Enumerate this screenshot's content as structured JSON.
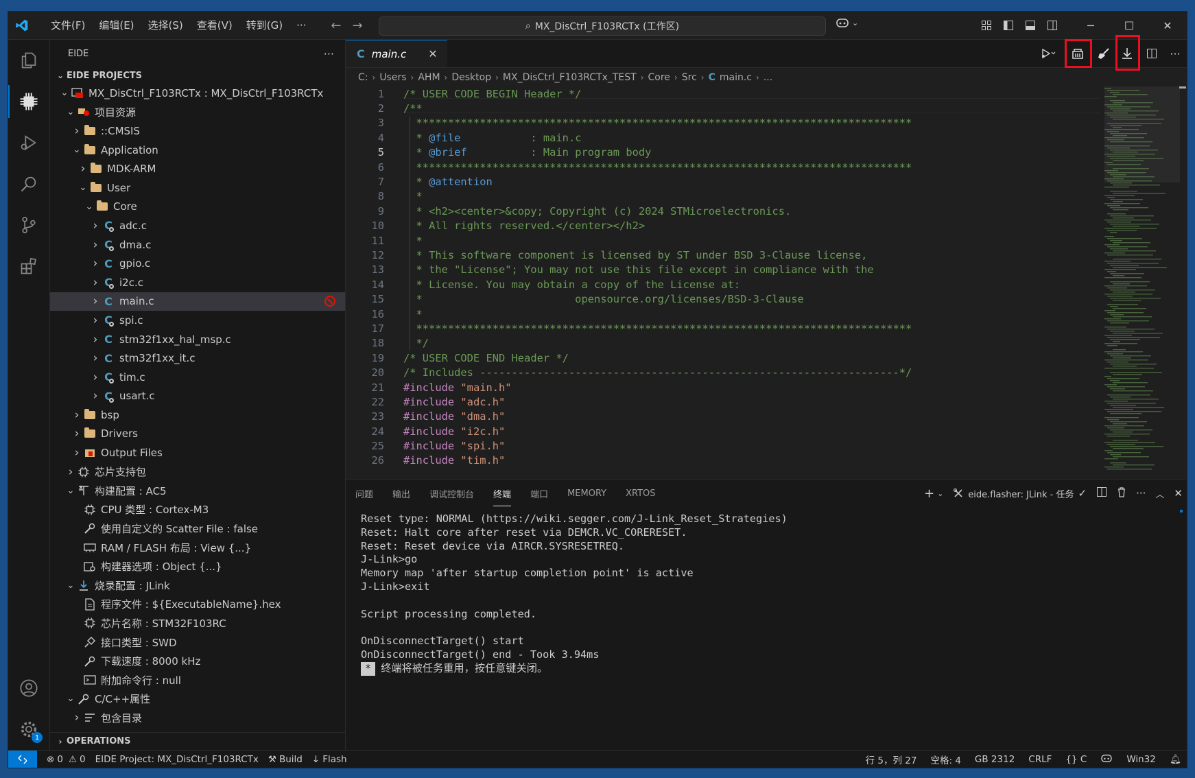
{
  "titlebar": {
    "menu": [
      "文件(F)",
      "编辑(E)",
      "选择(S)",
      "查看(V)",
      "转到(G)",
      "···"
    ],
    "search_text": "MX_DisCtrl_F103RCTx (工作区)"
  },
  "sidebar": {
    "header": "EIDE",
    "section": "EIDE PROJECTS",
    "operations": "OPERATIONS",
    "tree": [
      {
        "indent": 1,
        "chev": "v",
        "icon": "project",
        "label": "MX_DisCtrl_F103RCTx : MX_DisCtrl_F103RCTx"
      },
      {
        "indent": 2,
        "chev": "v",
        "icon": "resource",
        "label": "项目资源"
      },
      {
        "indent": 3,
        "chev": ">",
        "icon": "folder",
        "label": "::CMSIS"
      },
      {
        "indent": 3,
        "chev": "v",
        "icon": "folder",
        "label": "Application"
      },
      {
        "indent": 4,
        "chev": ">",
        "icon": "folder",
        "label": "MDK-ARM"
      },
      {
        "indent": 4,
        "chev": "v",
        "icon": "folder",
        "label": "User"
      },
      {
        "indent": 5,
        "chev": "v",
        "icon": "folder",
        "label": "Core"
      },
      {
        "indent": 6,
        "chev": ">",
        "icon": "cgear",
        "label": "adc.c"
      },
      {
        "indent": 6,
        "chev": ">",
        "icon": "cgear",
        "label": "dma.c"
      },
      {
        "indent": 6,
        "chev": ">",
        "icon": "c",
        "label": "gpio.c"
      },
      {
        "indent": 6,
        "chev": ">",
        "icon": "cgear",
        "label": "i2c.c"
      },
      {
        "indent": 6,
        "chev": ">",
        "icon": "c",
        "label": "main.c",
        "selected": true,
        "excluded": true
      },
      {
        "indent": 6,
        "chev": ">",
        "icon": "cgear",
        "label": "spi.c"
      },
      {
        "indent": 6,
        "chev": ">",
        "icon": "c",
        "label": "stm32f1xx_hal_msp.c"
      },
      {
        "indent": 6,
        "chev": ">",
        "icon": "c",
        "label": "stm32f1xx_it.c"
      },
      {
        "indent": 6,
        "chev": ">",
        "icon": "cgear",
        "label": "tim.c"
      },
      {
        "indent": 6,
        "chev": ">",
        "icon": "cgear",
        "label": "usart.c"
      },
      {
        "indent": 3,
        "chev": ">",
        "icon": "folder",
        "label": "bsp"
      },
      {
        "indent": 3,
        "chev": ">",
        "icon": "folder",
        "label": "Drivers"
      },
      {
        "indent": 3,
        "chev": ">",
        "icon": "output",
        "label": "Output Files"
      },
      {
        "indent": 2,
        "chev": ">",
        "icon": "chip",
        "label": "芯片支持包"
      },
      {
        "indent": 2,
        "chev": "v",
        "icon": "build",
        "label": "构建配置 : AC5"
      },
      {
        "indent": 3,
        "chev": "",
        "icon": "chip",
        "label": "CPU 类型 : Cortex-M3"
      },
      {
        "indent": 3,
        "chev": "",
        "icon": "wrench",
        "label": "使用自定义的 Scatter File : false"
      },
      {
        "indent": 3,
        "chev": "",
        "icon": "memory",
        "label": "RAM / FLASH 布局 : View {...}"
      },
      {
        "indent": 3,
        "chev": "",
        "icon": "options",
        "label": "构建器选项 : Object {...}"
      },
      {
        "indent": 2,
        "chev": "v",
        "icon": "download",
        "label": "烧录配置 : JLink"
      },
      {
        "indent": 3,
        "chev": "",
        "icon": "file",
        "label": "程序文件 : ${ExecutableName}.hex"
      },
      {
        "indent": 3,
        "chev": "",
        "icon": "chip",
        "label": "芯片名称 : STM32F103RC"
      },
      {
        "indent": 3,
        "chev": "",
        "icon": "plug",
        "label": "接口类型 : SWD"
      },
      {
        "indent": 3,
        "chev": "",
        "icon": "wrench",
        "label": "下载速度 : 8000 kHz"
      },
      {
        "indent": 3,
        "chev": "",
        "icon": "terminal",
        "label": "附加命令行 : null"
      },
      {
        "indent": 2,
        "chev": "v",
        "icon": "wrench",
        "label": "C/C++属性"
      },
      {
        "indent": 3,
        "chev": ">",
        "icon": "list",
        "label": "包含目录"
      }
    ]
  },
  "editor": {
    "tab_label": "main.c",
    "breadcrumb": [
      "C:",
      "Users",
      "AHM",
      "Desktop",
      "MX_DisCtrl_F103RCTx_TEST",
      "Core",
      "Src",
      "main.c",
      "..."
    ],
    "current_line": 5,
    "lines": [
      {
        "n": "1",
        "type": "comment",
        "text": "/* USER CODE BEGIN Header */"
      },
      {
        "n": "2",
        "type": "comment",
        "text": "/**"
      },
      {
        "n": "3",
        "type": "comment",
        "text": "  ******************************************************************************"
      },
      {
        "n": "4",
        "type": "tagc",
        "pre": "  * ",
        "tag": "@file",
        "post": "           : main.c"
      },
      {
        "n": "5",
        "type": "tagc",
        "pre": "  * ",
        "tag": "@brief",
        "post": "          : Main program body"
      },
      {
        "n": "6",
        "type": "comment",
        "text": "  ******************************************************************************"
      },
      {
        "n": "7",
        "type": "tagc",
        "pre": "  * ",
        "tag": "@attention",
        "post": ""
      },
      {
        "n": "8",
        "type": "comment",
        "text": "  *"
      },
      {
        "n": "9",
        "type": "comment",
        "text": "  * <h2><center>&copy; Copyright (c) 2024 STMicroelectronics."
      },
      {
        "n": "10",
        "type": "comment",
        "text": "  * All rights reserved.</center></h2>"
      },
      {
        "n": "11",
        "type": "comment",
        "text": "  *"
      },
      {
        "n": "12",
        "type": "comment",
        "text": "  * This software component is licensed by ST under BSD 3-Clause license,"
      },
      {
        "n": "13",
        "type": "comment",
        "text": "  * the \"License\"; You may not use this file except in compliance with the"
      },
      {
        "n": "14",
        "type": "comment",
        "text": "  * License. You may obtain a copy of the License at:"
      },
      {
        "n": "15",
        "type": "comment",
        "text": "  *                        opensource.org/licenses/BSD-3-Clause"
      },
      {
        "n": "16",
        "type": "comment",
        "text": "  *"
      },
      {
        "n": "17",
        "type": "comment",
        "text": "  ******************************************************************************"
      },
      {
        "n": "18",
        "type": "comment",
        "text": "  */"
      },
      {
        "n": "19",
        "type": "comment",
        "text": "/* USER CODE END Header */"
      },
      {
        "n": "20",
        "type": "comment",
        "text": "/* Includes ------------------------------------------------------------------*/"
      },
      {
        "n": "21",
        "type": "include",
        "kw": "#include",
        "str": " \"main.h\""
      },
      {
        "n": "22",
        "type": "include",
        "kw": "#include",
        "str": " \"adc.h\""
      },
      {
        "n": "23",
        "type": "include",
        "kw": "#include",
        "str": " \"dma.h\""
      },
      {
        "n": "24",
        "type": "include",
        "kw": "#include",
        "str": " \"i2c.h\""
      },
      {
        "n": "25",
        "type": "include",
        "kw": "#include",
        "str": " \"spi.h\""
      },
      {
        "n": "26",
        "type": "include",
        "kw": "#include",
        "str": " \"tim.h\""
      }
    ]
  },
  "panel": {
    "tabs": [
      "问题",
      "输出",
      "调试控制台",
      "终端",
      "端口",
      "MEMORY",
      "XRTOS"
    ],
    "active_tab": 3,
    "task_label": "eide.flasher: JLink - 任务",
    "terminal": [
      "Reset type: NORMAL (https://wiki.segger.com/J-Link_Reset_Strategies)",
      "Reset: Halt core after reset via DEMCR.VC_CORERESET.",
      "Reset: Reset device via AIRCR.SYSRESETREQ.",
      "J-Link>go",
      "Memory map 'after startup completion point' is active",
      "J-Link>exit",
      "",
      "Script processing completed.",
      "",
      "OnDisconnectTarget() start",
      "OnDisconnectTarget() end - Took 3.94ms"
    ],
    "terminal_mark": "*",
    "terminal_last": "终端将被任务重用，按任意键关闭。"
  },
  "statusbar": {
    "errors": "0",
    "warnings": "0",
    "project": "EIDE Project: MX_DisCtrl_F103RCTx",
    "build": "Build",
    "flash": "Flash",
    "position": "行 5，列 27",
    "spaces": "空格: 4",
    "encoding": "GB 2312",
    "eol": "CRLF",
    "language": "C",
    "platform": "Win32"
  },
  "activity_badge": "1"
}
